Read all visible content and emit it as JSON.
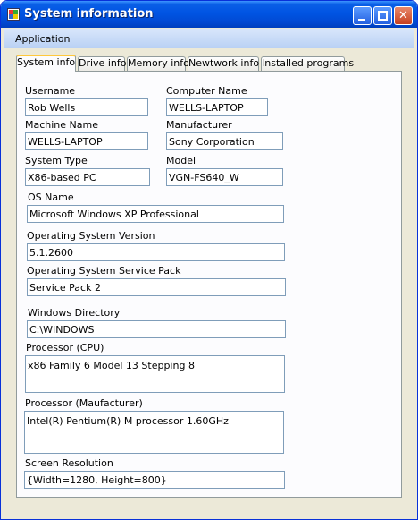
{
  "window": {
    "title": "System information"
  },
  "menu": {
    "application": "Application"
  },
  "tabs": [
    "System info",
    "Drive info",
    "Memory info",
    "Newtwork info",
    "Installed programs"
  ],
  "fields": {
    "username": {
      "label": "Username",
      "value": "Rob Wells"
    },
    "computer_name": {
      "label": "Computer Name",
      "value": "WELLS-LAPTOP"
    },
    "machine_name": {
      "label": "Machine Name",
      "value": "WELLS-LAPTOP"
    },
    "manufacturer": {
      "label": "Manufacturer",
      "value": "Sony Corporation"
    },
    "system_type": {
      "label": "System Type",
      "value": "X86-based PC"
    },
    "model": {
      "label": "Model",
      "value": "VGN-FS640_W"
    },
    "os_name": {
      "label": "OS Name",
      "value": "Microsoft Windows XP Professional"
    },
    "os_version": {
      "label": "Operating System Version",
      "value": "5.1.2600"
    },
    "os_service_pack": {
      "label": "Operating System Service Pack",
      "value": "Service Pack 2"
    },
    "windows_directory": {
      "label": "Windows Directory",
      "value": "C:\\WINDOWS"
    },
    "processor_cpu": {
      "label": "Processor  (CPU)",
      "value": "x86 Family 6 Model 13 Stepping 8"
    },
    "processor_manufacturer": {
      "label": "Processor  (Maufacturer)",
      "value": "Intel(R) Pentium(R) M processor 1.60GHz"
    },
    "screen_resolution": {
      "label": "Screen Resolution",
      "value": "{Width=1280, Height=800}"
    }
  }
}
